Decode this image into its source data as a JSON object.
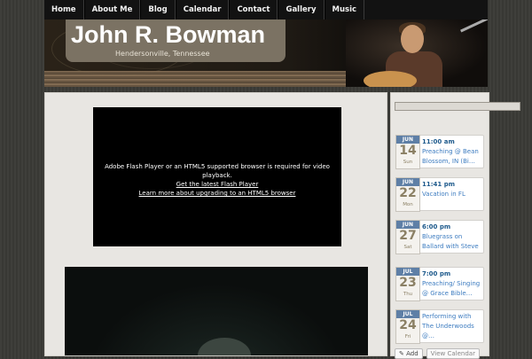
{
  "nav": {
    "items": [
      {
        "label": "Home"
      },
      {
        "label": "About Me"
      },
      {
        "label": "Blog"
      },
      {
        "label": "Calendar"
      },
      {
        "label": "Contact"
      },
      {
        "label": "Gallery"
      },
      {
        "label": "Music"
      }
    ]
  },
  "header": {
    "title": "John R. Bowman",
    "subtitle": "Hendersonville, Tennessee"
  },
  "video": {
    "message": "Adobe Flash Player or an HTML5 supported browser is required for video playback.",
    "link1": "Get the latest Flash Player",
    "link2": "Learn more about upgrading to an HTML5 browser"
  },
  "events": [
    {
      "mon": "JUN",
      "day": "14",
      "dow": "Sun",
      "time": "11:00 am",
      "title": "Preaching @ Bean Blossom, IN (Bi…"
    },
    {
      "mon": "JUN",
      "day": "22",
      "dow": "Mon",
      "time": "11:41 pm",
      "title": "Vacation in FL"
    },
    {
      "mon": "JUN",
      "day": "27",
      "dow": "Sat",
      "time": "6:00 pm",
      "title": "Bluegrass on Ballard with Steve … @ Olde City Park"
    },
    {
      "mon": "JUL",
      "day": "23",
      "dow": "Thu",
      "time": "7:00 pm",
      "title": "Preaching/ Singing @ Grace Bible…"
    },
    {
      "mon": "JUL",
      "day": "24",
      "dow": "Fri",
      "time": "",
      "title": "Performing with The Underwoods @…"
    }
  ],
  "sidebar": {
    "add_label": "Add",
    "view_label": "View Calendar"
  },
  "colors": {
    "accent": "#5e7fa6",
    "link": "#3d7cc0"
  }
}
